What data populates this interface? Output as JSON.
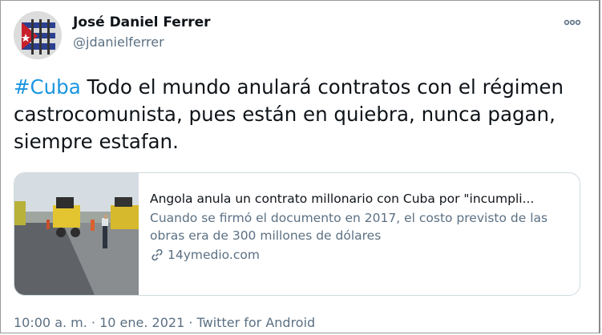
{
  "author": {
    "name": "José Daniel Ferrer",
    "handle": "@jdanielferrer"
  },
  "tweet": {
    "hashtag": "#Cuba",
    "text": " Todo el mundo anulará contratos con el régimen castrocomunista, pues están en quiebra, nunca pagan, siempre estafan."
  },
  "card": {
    "title": "Angola anula un contrato millonario con Cuba por \"incumpli...",
    "description": "Cuando se firmó el documento en 2017, el costo previsto de las obras era de 300 millones de dólares",
    "link": "14ymedio.com"
  },
  "meta": {
    "timestamp": "10:00 a. m. · 10 ene. 2021 · Twitter for Android"
  },
  "colors": {
    "hashtag": "#1b95e0",
    "secondary_text": "#5b7083"
  },
  "icons": {
    "more": "more-dots-icon",
    "link": "link-icon"
  }
}
